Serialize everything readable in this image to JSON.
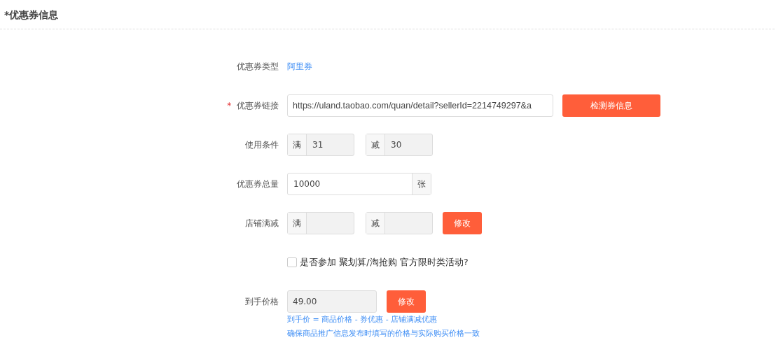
{
  "section_title": "*优惠券信息",
  "rows": [
    {
      "kind": "text",
      "label": "优惠券类型",
      "value": "阿里券"
    },
    {
      "kind": "input_button",
      "label": "优惠券链接",
      "marker": "*",
      "value": "https://uland.taobao.com/quan/detail?sellerId=2214749297&a",
      "disabled": false,
      "button": "检测券信息"
    },
    {
      "kind": "pair",
      "label": "使用条件",
      "parts": [
        {
          "prefix": "满",
          "value": "31",
          "disabled": true
        },
        {
          "prefix": "减",
          "value": "30",
          "disabled": true
        }
      ]
    },
    {
      "kind": "suffix",
      "label": "优惠券总量",
      "value": "10000",
      "suffix": "张",
      "disabled": false
    },
    {
      "kind": "pair",
      "label": "店铺满减",
      "parts": [
        {
          "prefix": "满",
          "disabled": true
        },
        {
          "prefix": "减",
          "disabled": true
        }
      ],
      "button": "修改"
    },
    {
      "kind": "checkbox",
      "text": "是否参加 聚划算/淘抢购 官方限时类活动?",
      "checked": false
    },
    {
      "kind": "input_button",
      "label": "到手价格",
      "value": "49.00",
      "disabled": true,
      "button": "修改",
      "notes": [
        "到手价 = 商品价格 - 券优惠 - 店铺满减优惠",
        "确保商品推广信息发布时填写的价格与实际购买价格一致"
      ]
    }
  ]
}
